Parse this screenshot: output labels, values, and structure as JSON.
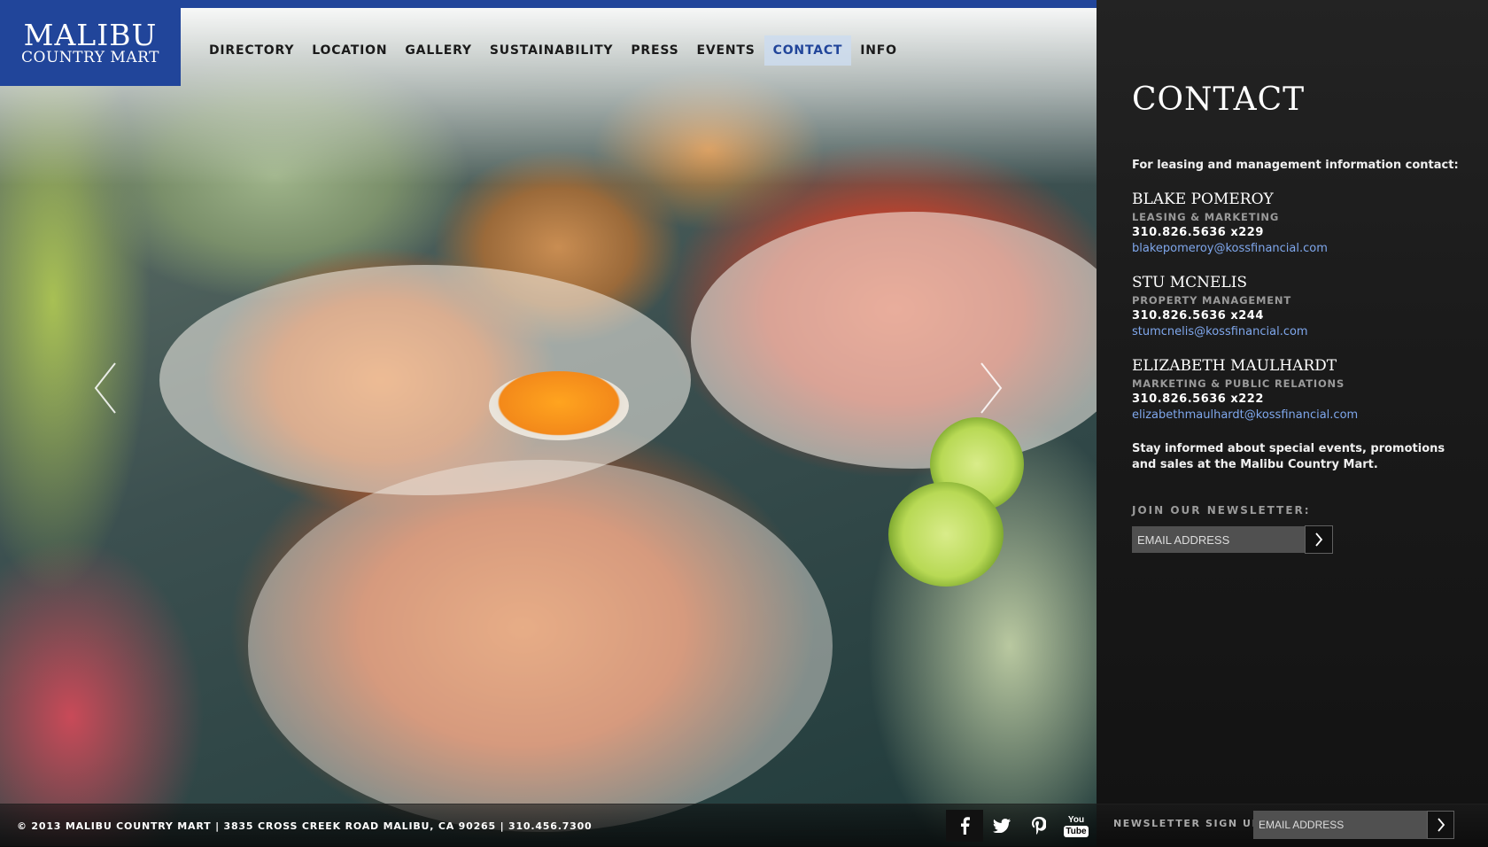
{
  "brand": {
    "line1": "MALIBU",
    "line2": "COUNTRY MART",
    "color": "#21459a"
  },
  "nav": {
    "items": [
      {
        "label": "DIRECTORY"
      },
      {
        "label": "LOCATION"
      },
      {
        "label": "GALLERY"
      },
      {
        "label": "SUSTAINABILITY"
      },
      {
        "label": "PRESS"
      },
      {
        "label": "EVENTS"
      },
      {
        "label": "CONTACT",
        "active": true
      },
      {
        "label": "INFO"
      }
    ]
  },
  "slideshow": {
    "prev_icon": "chevron-left-icon",
    "next_icon": "chevron-right-icon"
  },
  "contact": {
    "title": "CONTACT",
    "intro": "For leasing and management information contact:",
    "people": [
      {
        "name": "BLAKE POMEROY",
        "role": "LEASING & MARKETING",
        "phone": "310.826.5636 x229",
        "email": "blakepomeroy@kossfinancial.com"
      },
      {
        "name": "STU MCNELIS",
        "role": "PROPERTY MANAGEMENT",
        "phone": "310.826.5636 x244",
        "email": "stumcnelis@kossfinancial.com"
      },
      {
        "name": "ELIZABETH MAULHARDT",
        "role": "MARKETING & PUBLIC RELATIONS",
        "phone": "310.826.5636 x222",
        "email": "elizabethmaulhardt@kossfinancial.com"
      }
    ],
    "stay_informed": "Stay informed about special events, promotions and sales at the Malibu Country Mart.",
    "newsletter_label": "JOIN OUR NEWSLETTER:",
    "newsletter_placeholder": "EMAIL ADDRESS",
    "link_color": "#7fa7ec"
  },
  "footer": {
    "copyright": "© 2013 MALIBU COUNTRY MART | 3835 CROSS CREEK ROAD MALIBU, CA 90265 | 310.456.7300",
    "social": [
      "facebook-icon",
      "twitter-icon",
      "pinterest-icon",
      "youtube-icon"
    ],
    "youtube_line1": "You",
    "youtube_line2": "Tube",
    "newsletter_label": "NEWSLETTER SIGN UP:",
    "newsletter_placeholder": "EMAIL ADDRESS"
  }
}
